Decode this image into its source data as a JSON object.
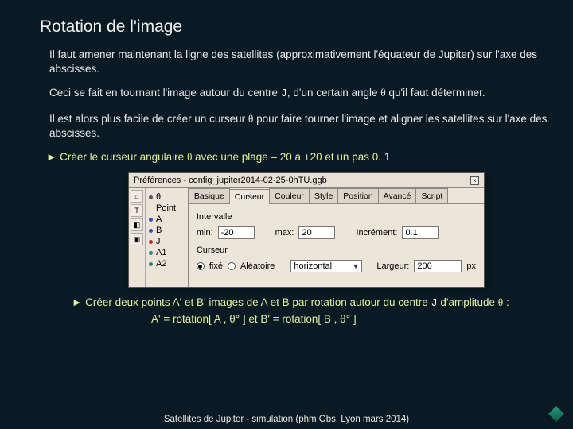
{
  "title": "Rotation de l'image",
  "p1": "Il faut amener maintenant la ligne des satellites (approximativement l'équateur de Jupiter) sur l'axe des abscisses.",
  "p2a": "Ceci se fait en tournant l'image autour du centre ",
  "p2J": "J",
  "p2b": ", d'un certain angle  ",
  "p2theta": "θ",
  "p2c": " qu'il faut déterminer.",
  "p3a": "Il est alors plus facile de créer un curseur ",
  "p3theta": "θ",
  "p3b": "  pour faire tourner l'image et aligner les satellites sur l'axe des abscisses.",
  "instr1a": "►  Créer le curseur angulaire ",
  "instr1theta": "θ",
  "instr1b": " avec une plage – 20 à +20 et un pas 0. 1",
  "dlg": {
    "title": "Préférences - config_jupiter2014-02-25-0hTU.ggb",
    "left": {
      "theta": "θ",
      "point": "Point",
      "a": "A",
      "b": "B",
      "j": "J",
      "a1": "A1",
      "a2": "A2"
    },
    "tabs": {
      "t0": "Basique",
      "t1": "Curseur",
      "t2": "Couleur",
      "t3": "Style",
      "t4": "Position",
      "t5": "Avancé",
      "t6": "Script"
    },
    "intervalle": "Intervalle",
    "min_lbl": "min:",
    "min_val": "-20",
    "max_lbl": "max:",
    "max_val": "20",
    "incr_lbl": "Incrément:",
    "incr_val": "0.1",
    "curseur": "Curseur",
    "fixe": "fixé",
    "alea": "Aléatoire",
    "orient": "horizontal",
    "larg_lbl": "Largeur:",
    "larg_val": "200",
    "px": "px"
  },
  "instr2a": "►  Créer deux points A' et  B'  images de A et B par rotation autour du centre ",
  "instr2J": "J",
  "instr2b": " d'amplitude ",
  "instr2theta": "θ",
  "instr2c": "  :",
  "eq": "A' = rotation[ A , θ° ]      et      B' = rotation[ B , θ° ]",
  "footer": "Satellites de Jupiter - simulation (phm Obs. Lyon mars 2014)"
}
